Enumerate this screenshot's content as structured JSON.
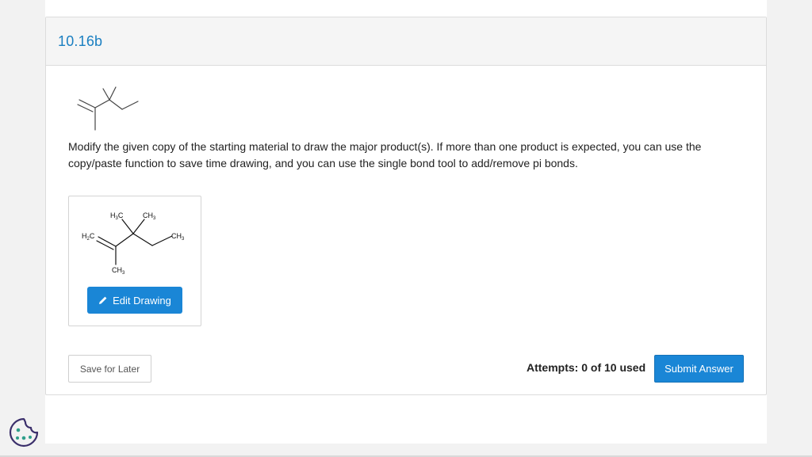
{
  "question": {
    "number": "10.16b",
    "prompt": "Modify the given copy of the starting material to draw the major product(s). If more than one product is expected, you can use the copy/paste function to save time drawing, and you can use the single bond tool to add/remove pi bonds."
  },
  "drawing": {
    "edit_label": "Edit Drawing",
    "atom_labels": {
      "h3c_top": "H",
      "h3c_top_sub": "3",
      "h3c_top_c": "C",
      "ch3_top": "CH",
      "ch3_top_sub": "3",
      "h2c_left": "H",
      "h2c_left_sub": "2",
      "h2c_left_c": "C",
      "ch3_right": "CH",
      "ch3_right_sub": "3",
      "ch3_bottom": "CH",
      "ch3_bottom_sub": "3"
    }
  },
  "footer": {
    "save_label": "Save for Later",
    "attempts_label": "Attempts: 0 of 10 used",
    "submit_label": "Submit Answer"
  },
  "colors": {
    "accent": "#1a86d6",
    "title": "#1a7fc1"
  },
  "icons": {
    "edit": "pencil-icon",
    "cookie": "cookie-icon"
  }
}
